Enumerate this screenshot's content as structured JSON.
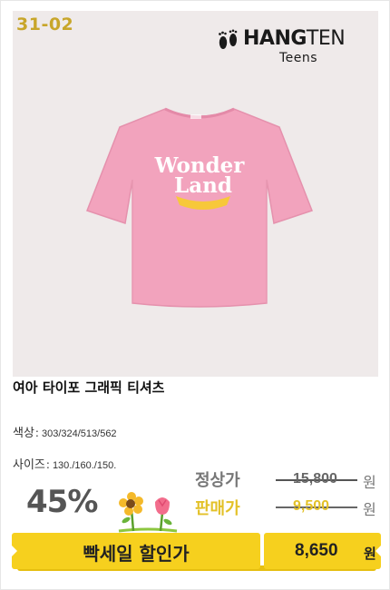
{
  "product": {
    "code": "31-02",
    "title": "여아 타이포 그래픽 티셔츠",
    "print_line1": "Wonder",
    "print_line2": "Land"
  },
  "brand": {
    "name_bold": "HANG",
    "name_thin": "TEN",
    "sub": "Teens",
    "icon": "footprints-icon"
  },
  "specs": {
    "color_label": "색상",
    "color_value": "303/324/513/562",
    "size_label": "사이즈",
    "size_value": "130./160./150.",
    "separator": ":"
  },
  "pricing": {
    "discount": "45%",
    "regular_label": "정상가",
    "regular_price": "15,800",
    "sale_label": "판매가",
    "sale_price": "9,500",
    "currency": "원",
    "promo_label": "빡세일 할인가",
    "final_price": "8,650",
    "final_currency": "원"
  },
  "colors": {
    "accent_yellow": "#f6d01e",
    "code_gold": "#c8a62a",
    "shirt_pink": "#f2a3bd",
    "photo_bg": "#efeaea"
  }
}
